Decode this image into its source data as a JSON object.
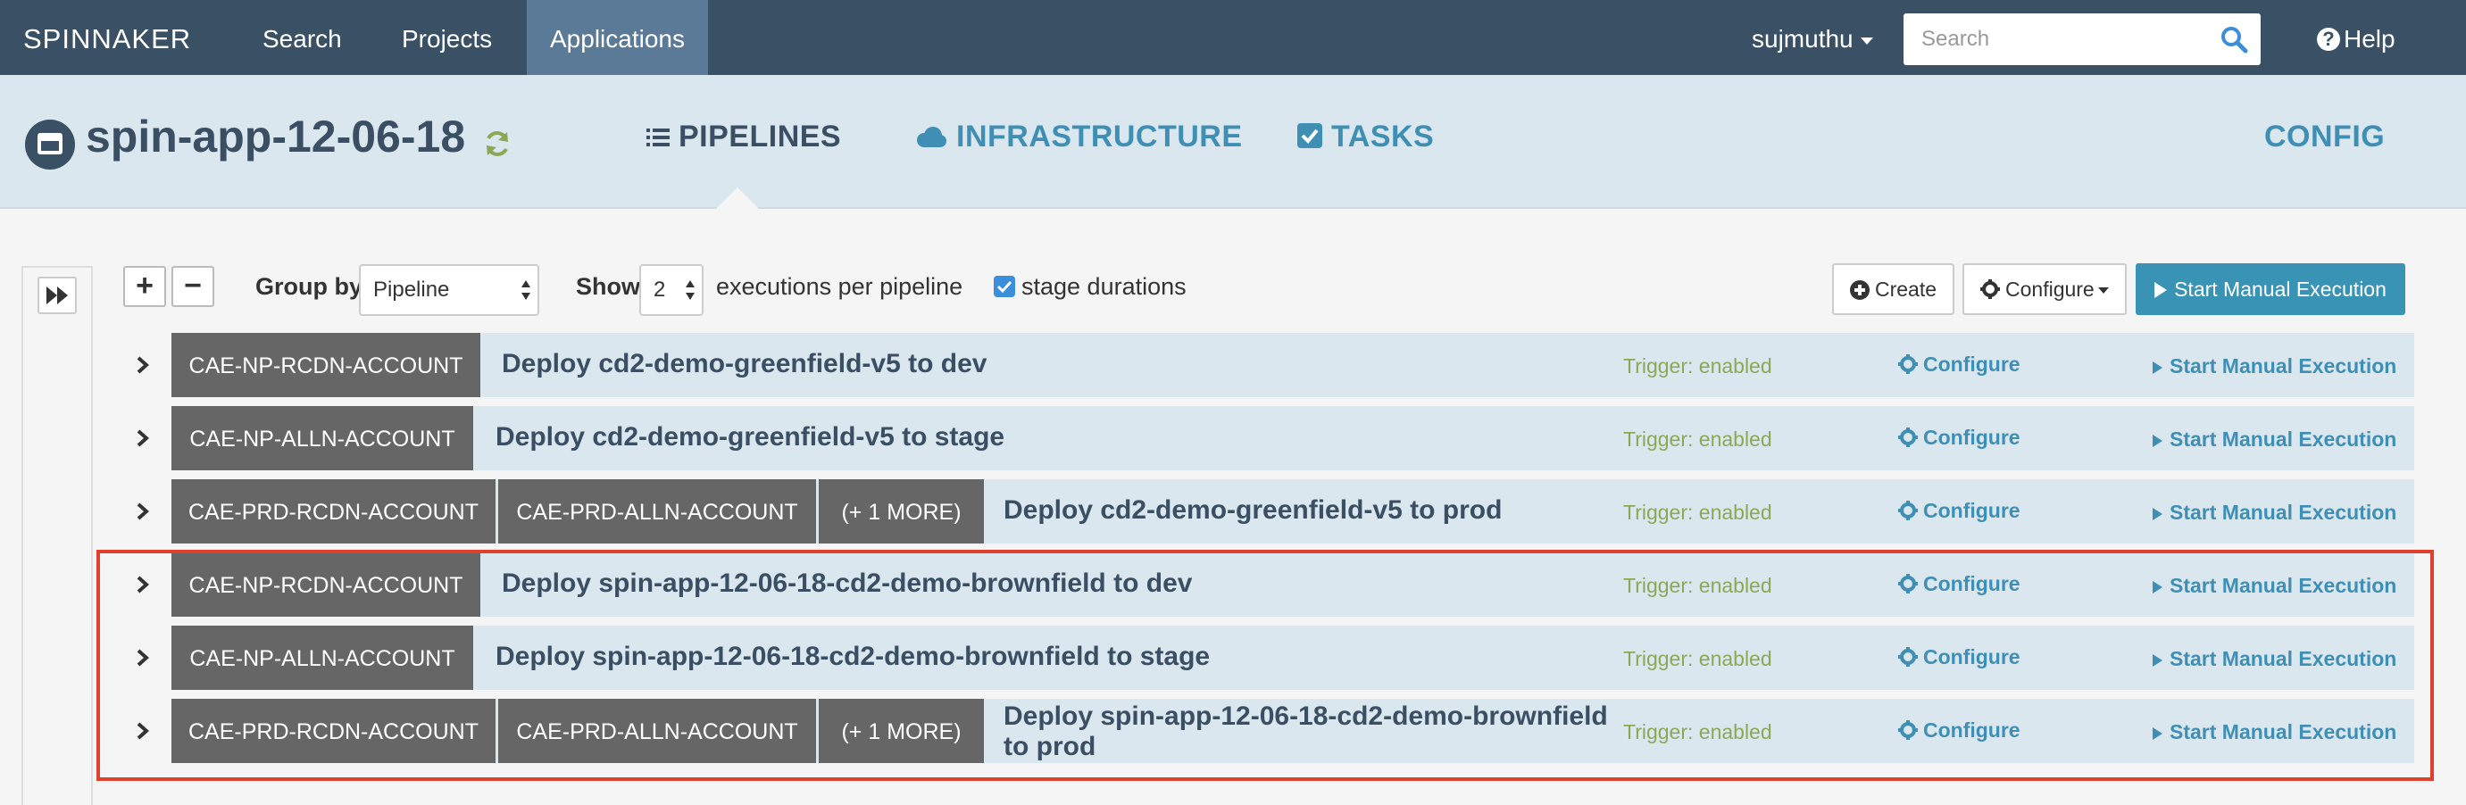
{
  "navbar": {
    "brand": "SPINNAKER",
    "items": [
      {
        "label": "Search"
      },
      {
        "label": "Projects"
      },
      {
        "label": "Applications"
      }
    ],
    "user": "sujmuthu",
    "search_placeholder": "Search",
    "help": "Help",
    "colors": {
      "background": "#395065",
      "active": "#5b7a98"
    }
  },
  "app": {
    "name": "spin-app-12-06-18",
    "tabs": [
      {
        "label": "PIPELINES",
        "icon": "list-icon"
      },
      {
        "label": "INFRASTRUCTURE",
        "icon": "cloud-icon"
      },
      {
        "label": "TASKS",
        "icon": "checkbox-icon"
      }
    ],
    "config": "CONFIG"
  },
  "toolbar": {
    "expand_all": "+",
    "collapse_all": "−",
    "group_by_label": "Group by",
    "group_by_value": "Pipeline",
    "show_label": "Show",
    "show_value": "2",
    "executions_label": "executions per pipeline",
    "stage_durations_label": "stage durations",
    "stage_durations_checked": true,
    "create_label": "Create",
    "configure_label": "Configure",
    "start_label": "Start Manual Execution"
  },
  "pipelines": [
    {
      "accounts": [
        "CAE-NP-RCDN-ACCOUNT"
      ],
      "name": "Deploy cd2-demo-greenfield-v5 to dev",
      "trigger": "Trigger: enabled",
      "configure": "Configure",
      "start": "Start Manual Execution"
    },
    {
      "accounts": [
        "CAE-NP-ALLN-ACCOUNT"
      ],
      "name": "Deploy cd2-demo-greenfield-v5 to stage",
      "trigger": "Trigger: enabled",
      "configure": "Configure",
      "start": "Start Manual Execution"
    },
    {
      "accounts": [
        "CAE-PRD-RCDN-ACCOUNT",
        "CAE-PRD-ALLN-ACCOUNT",
        "(+ 1 MORE)"
      ],
      "name": "Deploy cd2-demo-greenfield-v5 to prod",
      "trigger": "Trigger: enabled",
      "configure": "Configure",
      "start": "Start Manual Execution"
    },
    {
      "accounts": [
        "CAE-NP-RCDN-ACCOUNT"
      ],
      "name": "Deploy spin-app-12-06-18-cd2-demo-brownfield to dev",
      "trigger": "Trigger: enabled",
      "configure": "Configure",
      "start": "Start Manual Execution"
    },
    {
      "accounts": [
        "CAE-NP-ALLN-ACCOUNT"
      ],
      "name": "Deploy spin-app-12-06-18-cd2-demo-brownfield to stage",
      "trigger": "Trigger: enabled",
      "configure": "Configure",
      "start": "Start Manual Execution"
    },
    {
      "accounts": [
        "CAE-PRD-RCDN-ACCOUNT",
        "CAE-PRD-ALLN-ACCOUNT",
        "(+ 1 MORE)"
      ],
      "name": "Deploy spin-app-12-06-18-cd2-demo-brownfield to prod",
      "trigger": "Trigger: enabled",
      "configure": "Configure",
      "start": "Start Manual Execution"
    }
  ]
}
